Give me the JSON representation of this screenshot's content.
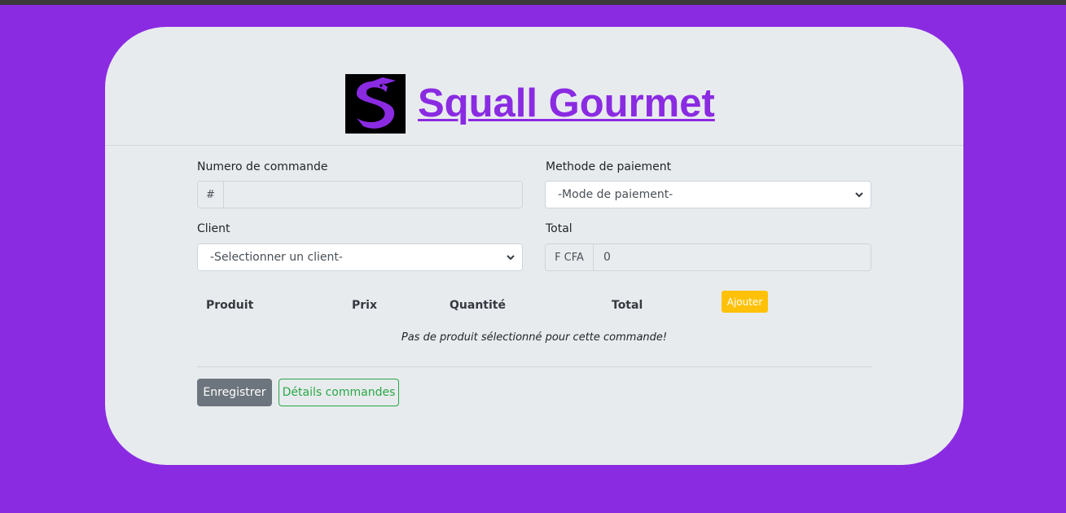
{
  "header": {
    "brand_name": "Squall Gourmet",
    "logo_icon": "shark-logo-icon"
  },
  "form": {
    "order_number": {
      "label": "Numero de commande",
      "prefix": "#",
      "value": ""
    },
    "payment_method": {
      "label": "Methode de paiement",
      "selected": "-Mode de paiement-"
    },
    "client": {
      "label": "Client",
      "selected": "-Selectionner un client-"
    },
    "total": {
      "label": "Total",
      "prefix": "F CFA",
      "value": "0"
    }
  },
  "products_table": {
    "columns": [
      "Produit",
      "Prix",
      "Quantité",
      "Total"
    ],
    "add_button": "Ajouter",
    "empty_message": "Pas de produit sélectionné pour cette commande!"
  },
  "actions": {
    "save_label": "Enregistrer",
    "details_label": "Détails commandes"
  },
  "colors": {
    "background": "#8a2be2",
    "card": "#e8ebee",
    "brand": "#8a2be2",
    "warning": "#ffc107",
    "secondary": "#6c757d",
    "success": "#28a745"
  }
}
